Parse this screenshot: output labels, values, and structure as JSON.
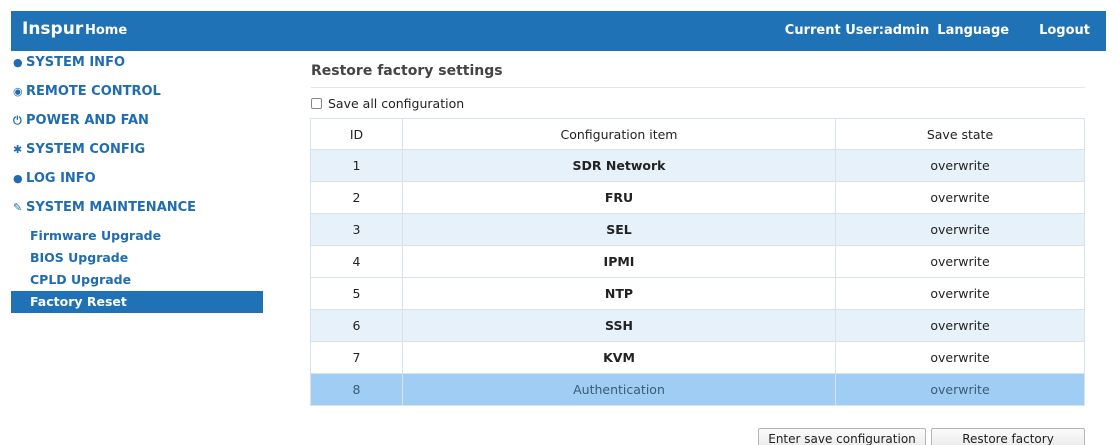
{
  "header": {
    "brand": "Inspur",
    "home": "Home",
    "current_user": "Current User:admin",
    "language": "Language",
    "logout": "Logout"
  },
  "sidebar": {
    "sections": [
      {
        "label": "SYSTEM INFO",
        "icon": "eye-icon"
      },
      {
        "label": "REMOTE CONTROL",
        "icon": "globe-icon"
      },
      {
        "label": "POWER AND FAN",
        "icon": "power-icon"
      },
      {
        "label": "SYSTEM CONFIG",
        "icon": "gear-icon"
      },
      {
        "label": "LOG INFO",
        "icon": "info-icon"
      },
      {
        "label": "SYSTEM MAINTENANCE",
        "icon": "wrench-icon"
      }
    ],
    "sub_items": [
      {
        "label": "Firmware Upgrade"
      },
      {
        "label": "BIOS Upgrade"
      },
      {
        "label": "CPLD Upgrade"
      },
      {
        "label": "Factory Reset",
        "active": true
      }
    ]
  },
  "main": {
    "title": "Restore factory settings",
    "save_all_label": "Save all configuration",
    "table": {
      "headers": [
        "ID",
        "Configuration item",
        "Save state"
      ],
      "rows": [
        {
          "id": "1",
          "item": "SDR Network",
          "state": "overwrite"
        },
        {
          "id": "2",
          "item": "FRU",
          "state": "overwrite"
        },
        {
          "id": "3",
          "item": "SEL",
          "state": "overwrite"
        },
        {
          "id": "4",
          "item": "IPMI",
          "state": "overwrite"
        },
        {
          "id": "5",
          "item": "NTP",
          "state": "overwrite"
        },
        {
          "id": "6",
          "item": "SSH",
          "state": "overwrite"
        },
        {
          "id": "7",
          "item": "KVM",
          "state": "overwrite"
        },
        {
          "id": "8",
          "item": "Authentication",
          "state": "overwrite",
          "selected": true
        }
      ]
    },
    "buttons": {
      "enter_save": "Enter save configuration",
      "restore": "Restore factory settings"
    }
  },
  "colors": {
    "brand_blue": "#1f72b6",
    "row_alt": "#e7f1f9",
    "row_selected": "#9fcdf3"
  }
}
